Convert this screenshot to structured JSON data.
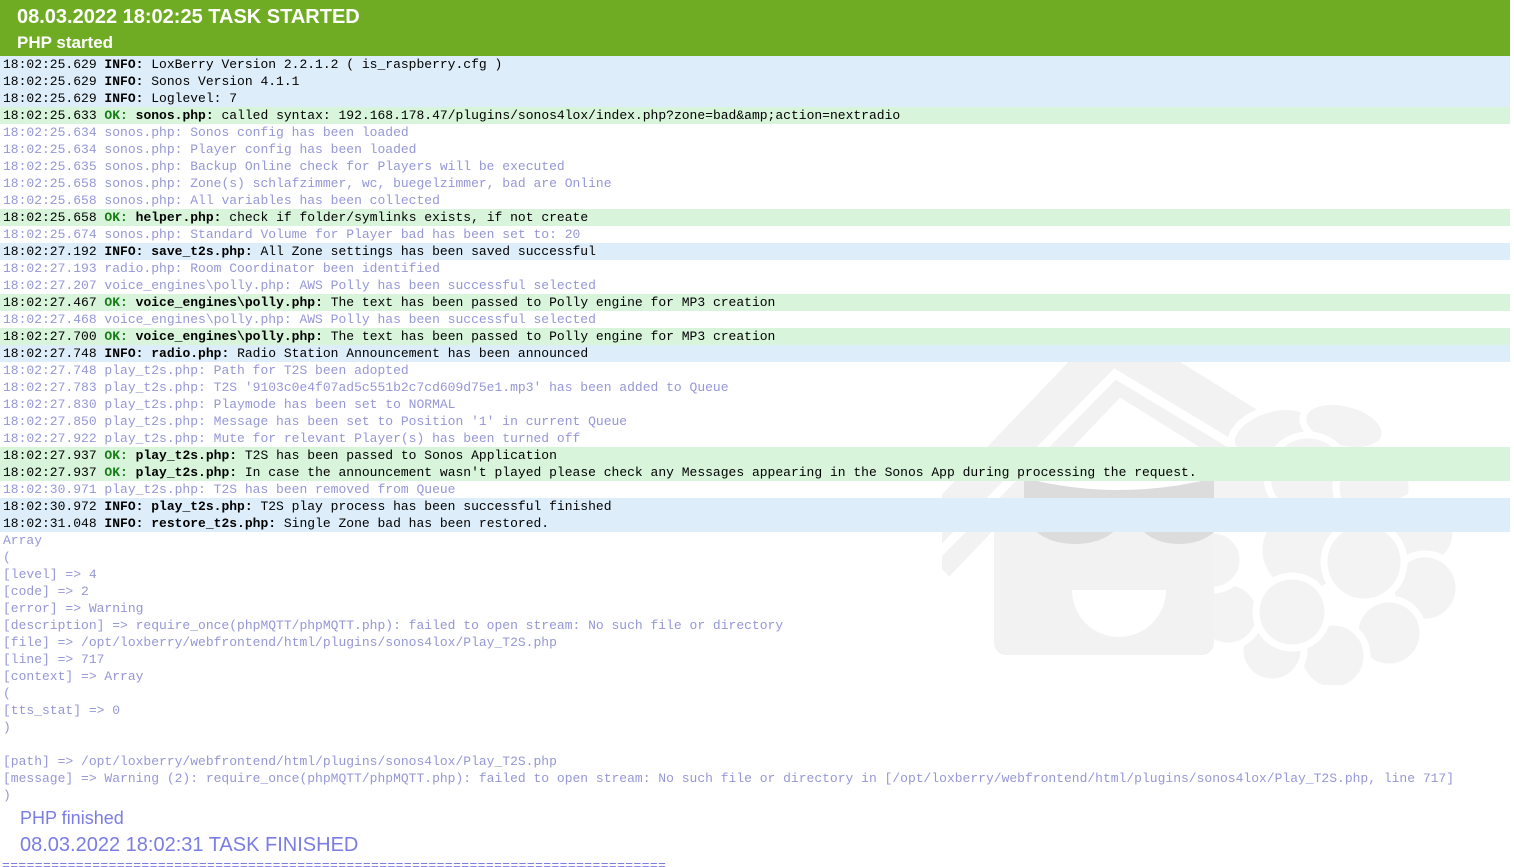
{
  "header": {
    "line1": "08.03.2022 18:02:25 TASK STARTED",
    "line2": "PHP started"
  },
  "log_lines": [
    {
      "type": "info",
      "time": "18:02:25.629",
      "level": "INFO:",
      "script": "",
      "msg": "LoxBerry Version 2.2.1.2 ( is_raspberry.cfg )"
    },
    {
      "type": "info",
      "time": "18:02:25.629",
      "level": "INFO:",
      "script": "",
      "msg": "Sonos Version 4.1.1"
    },
    {
      "type": "info",
      "time": "18:02:25.629",
      "level": "INFO:",
      "script": "",
      "msg": "Loglevel: 7"
    },
    {
      "type": "ok",
      "time": "18:02:25.633",
      "level": "OK:",
      "script": "sonos.php:",
      "msg": "called syntax: 192.168.178.47/plugins/sonos4lox/index.php?zone=bad&amp;action=nextradio"
    },
    {
      "type": "plain",
      "time": "18:02:25.634",
      "level": "",
      "script": "",
      "msg": "sonos.php: Sonos config has been loaded"
    },
    {
      "type": "plain",
      "time": "18:02:25.634",
      "level": "",
      "script": "",
      "msg": "sonos.php: Player config has been loaded"
    },
    {
      "type": "plain",
      "time": "18:02:25.635",
      "level": "",
      "script": "",
      "msg": "sonos.php: Backup Online check for Players will be executed"
    },
    {
      "type": "plain",
      "time": "18:02:25.658",
      "level": "",
      "script": "",
      "msg": "sonos.php: Zone(s) schlafzimmer, wc, buegelzimmer, bad are Online"
    },
    {
      "type": "plain",
      "time": "18:02:25.658",
      "level": "",
      "script": "",
      "msg": "sonos.php: All variables has been collected"
    },
    {
      "type": "ok",
      "time": "18:02:25.658",
      "level": "OK:",
      "script": "helper.php:",
      "msg": "check if folder/symlinks exists, if not create"
    },
    {
      "type": "plain",
      "time": "18:02:25.674",
      "level": "",
      "script": "",
      "msg": "sonos.php: Standard Volume for Player bad has been set to: 20"
    },
    {
      "type": "info",
      "time": "18:02:27.192",
      "level": "INFO:",
      "script": "save_t2s.php:",
      "msg": "All Zone settings has been saved successful"
    },
    {
      "type": "plain",
      "time": "18:02:27.193",
      "level": "",
      "script": "",
      "msg": "radio.php: Room Coordinator been identified"
    },
    {
      "type": "plain",
      "time": "18:02:27.207",
      "level": "",
      "script": "",
      "msg": "voice_engines\\polly.php: AWS Polly has been successful selected"
    },
    {
      "type": "ok",
      "time": "18:02:27.467",
      "level": "OK:",
      "script": "voice_engines\\polly.php:",
      "msg": "The text has been passed to Polly engine for MP3 creation"
    },
    {
      "type": "plain",
      "time": "18:02:27.468",
      "level": "",
      "script": "",
      "msg": "voice_engines\\polly.php: AWS Polly has been successful selected"
    },
    {
      "type": "ok",
      "time": "18:02:27.700",
      "level": "OK:",
      "script": "voice_engines\\polly.php:",
      "msg": "The text has been passed to Polly engine for MP3 creation"
    },
    {
      "type": "info",
      "time": "18:02:27.748",
      "level": "INFO:",
      "script": "radio.php:",
      "msg": "Radio Station Announcement has been announced"
    },
    {
      "type": "plain",
      "time": "18:02:27.748",
      "level": "",
      "script": "",
      "msg": "play_t2s.php: Path for T2S been adopted"
    },
    {
      "type": "plain",
      "time": "18:02:27.783",
      "level": "",
      "script": "",
      "msg": "play_t2s.php: T2S '9103c0e4f07ad5c551b2c7cd609d75e1.mp3' has been added to Queue"
    },
    {
      "type": "plain",
      "time": "18:02:27.830",
      "level": "",
      "script": "",
      "msg": "play_t2s.php: Playmode has been set to NORMAL"
    },
    {
      "type": "plain",
      "time": "18:02:27.850",
      "level": "",
      "script": "",
      "msg": "play_t2s.php: Message has been set to Position '1' in current Queue"
    },
    {
      "type": "plain",
      "time": "18:02:27.922",
      "level": "",
      "script": "",
      "msg": "play_t2s.php: Mute for relevant Player(s) has been turned off"
    },
    {
      "type": "ok",
      "time": "18:02:27.937",
      "level": "OK:",
      "script": "play_t2s.php:",
      "msg": "T2S has been passed to Sonos Application"
    },
    {
      "type": "ok",
      "time": "18:02:27.937",
      "level": "OK:",
      "script": "play_t2s.php:",
      "msg": "In case the announcement wasn't played please check any Messages appearing in the Sonos App during processing the request."
    },
    {
      "type": "plain",
      "time": "18:02:30.971",
      "level": "",
      "script": "",
      "msg": "play_t2s.php: T2S has been removed from Queue"
    },
    {
      "type": "info",
      "time": "18:02:30.972",
      "level": "INFO:",
      "script": "play_t2s.php:",
      "msg": "T2S play process has been successful finished"
    },
    {
      "type": "info",
      "time": "18:02:31.048",
      "level": "INFO:",
      "script": "restore_t2s.php:",
      "msg": "Single Zone bad has been restored."
    },
    {
      "type": "plain",
      "time": "",
      "level": "",
      "script": "",
      "msg": "Array"
    },
    {
      "type": "plain",
      "time": "",
      "level": "",
      "script": "",
      "msg": "("
    },
    {
      "type": "plain",
      "time": "",
      "level": "",
      "script": "",
      "msg": "[level] => 4"
    },
    {
      "type": "plain",
      "time": "",
      "level": "",
      "script": "",
      "msg": "[code] => 2"
    },
    {
      "type": "plain",
      "time": "",
      "level": "",
      "script": "",
      "msg": "[error] => Warning"
    },
    {
      "type": "plain",
      "time": "",
      "level": "",
      "script": "",
      "msg": "[description] => require_once(phpMQTT/phpMQTT.php): failed to open stream: No such file or directory"
    },
    {
      "type": "plain",
      "time": "",
      "level": "",
      "script": "",
      "msg": "[file] => /opt/loxberry/webfrontend/html/plugins/sonos4lox/Play_T2S.php"
    },
    {
      "type": "plain",
      "time": "",
      "level": "",
      "script": "",
      "msg": "[line] => 717"
    },
    {
      "type": "plain",
      "time": "",
      "level": "",
      "script": "",
      "msg": "[context] => Array"
    },
    {
      "type": "plain",
      "time": "",
      "level": "",
      "script": "",
      "msg": "("
    },
    {
      "type": "plain",
      "time": "",
      "level": "",
      "script": "",
      "msg": "[tts_stat] => 0"
    },
    {
      "type": "plain",
      "time": "",
      "level": "",
      "script": "",
      "msg": ")"
    },
    {
      "type": "blank",
      "time": "",
      "level": "",
      "script": "",
      "msg": ""
    },
    {
      "type": "plain",
      "time": "",
      "level": "",
      "script": "",
      "msg": "[path] => /opt/loxberry/webfrontend/html/plugins/sonos4lox/Play_T2S.php"
    },
    {
      "type": "plain",
      "time": "",
      "level": "",
      "script": "",
      "msg": "[message] => Warning (2): require_once(phpMQTT/phpMQTT.php): failed to open stream: No such file or directory in [/opt/loxberry/webfrontend/html/plugins/sonos4lox/Play_T2S.php, line 717]"
    },
    {
      "type": "plain",
      "time": "",
      "level": "",
      "script": "",
      "msg": ")"
    }
  ],
  "footer": {
    "php_finished": "PHP finished",
    "task_finished": "08.03.2022 18:02:31 TASK FINISHED",
    "separator": "================================================================================="
  },
  "colors": {
    "header_bg": "#6fac24",
    "info_bg": "#ddedfa",
    "ok_bg": "#d8f5dc",
    "ok_green": "#177d17",
    "plain_text": "#9597d6",
    "footer_text": "#7b7de2"
  },
  "watermark_icon": "loxberry-raspberry-logo"
}
